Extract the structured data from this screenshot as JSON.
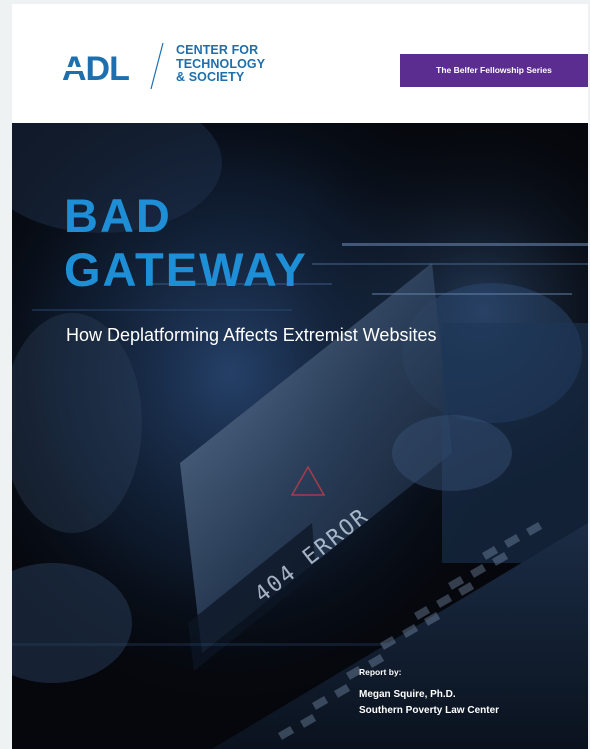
{
  "header": {
    "brand_logo_text": "ADL",
    "center_lines": [
      "CENTER FOR",
      "TECHNOLOGY",
      "& SOCIETY"
    ],
    "series_badge": "The Belfer Fellowship Series"
  },
  "cover": {
    "title_lines": [
      "BAD",
      "GATEWAY"
    ],
    "subtitle": "How Deplatforming Affects Extremist Websites",
    "screen_text": "404 ERROR",
    "report_label": "Report by:",
    "author_lines": [
      "Megan Squire, Ph.D.",
      "Southern Poverty Law Center"
    ]
  },
  "colors": {
    "brand_blue": "#1d6fae",
    "title_blue": "#1e8fd6",
    "series_purple": "#5b2d91",
    "cover_background": "#05070c"
  }
}
